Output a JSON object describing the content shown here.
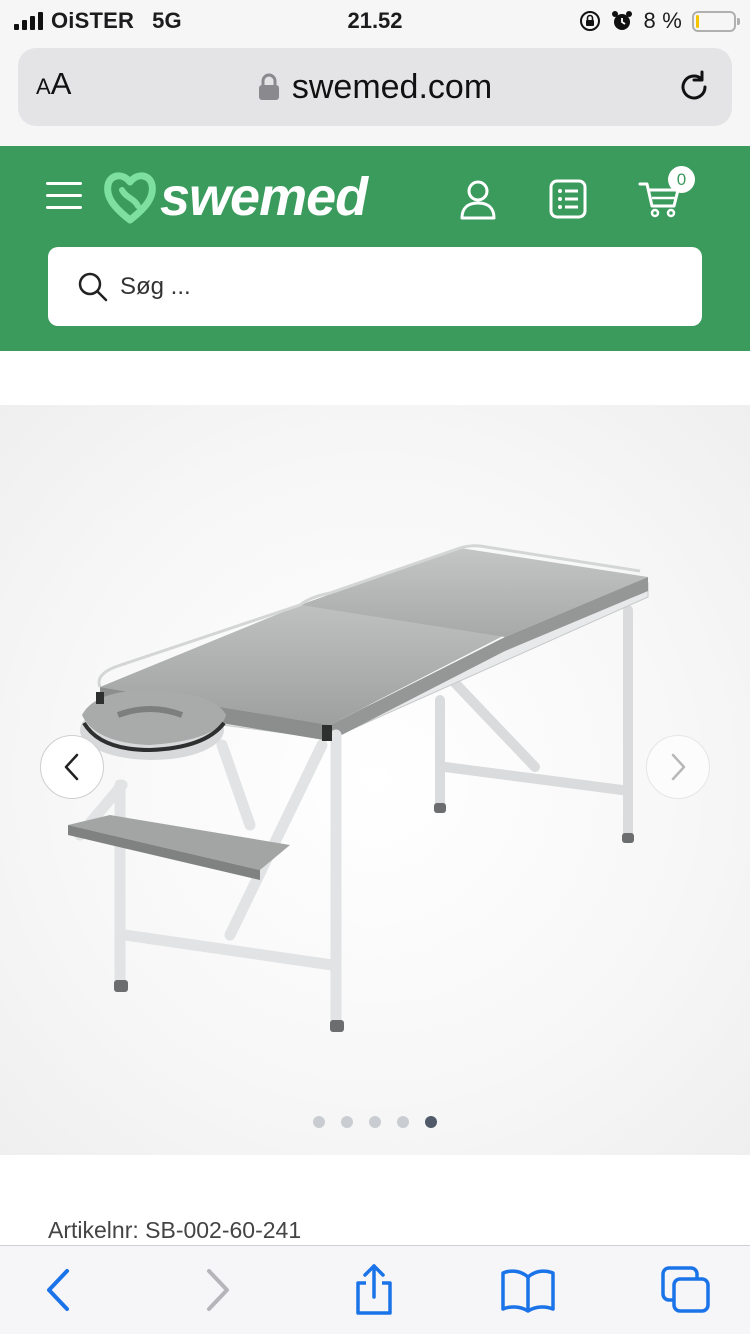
{
  "status_bar": {
    "carrier": "OiSTER",
    "network": "5G",
    "time": "21.52",
    "battery_percent_text": "8 %",
    "battery_level": 0.08,
    "icons": [
      "signal-bars-icon",
      "orientation-lock-icon",
      "alarm-icon",
      "battery-icon"
    ]
  },
  "browser": {
    "text_size_label": "AA",
    "url": "swemed.com",
    "secure_icon": "lock-icon",
    "reload_icon": "reload-icon"
  },
  "header": {
    "brand_name": "swemed",
    "brand_color": "#3a9b5c",
    "logo_mark_color": "#7ee0a0",
    "menu_icon": "hamburger-icon",
    "account_icon": "user-icon",
    "list_icon": "list-icon",
    "cart_icon": "cart-icon",
    "cart_count": "0",
    "search": {
      "placeholder": "Søg ..."
    }
  },
  "gallery": {
    "image_description_icon": "massage-table-image",
    "prev_icon": "chevron-left-icon",
    "next_icon": "chevron-right-icon",
    "slide_count": 5,
    "active_slide": 5
  },
  "product": {
    "article_number_text": "Artikelnr: SB-002-60-241"
  },
  "toolbar": {
    "icons": [
      "back-icon",
      "forward-icon",
      "share-icon",
      "bookmarks-icon",
      "tabs-icon"
    ],
    "accent_color": "#1a73e8"
  }
}
